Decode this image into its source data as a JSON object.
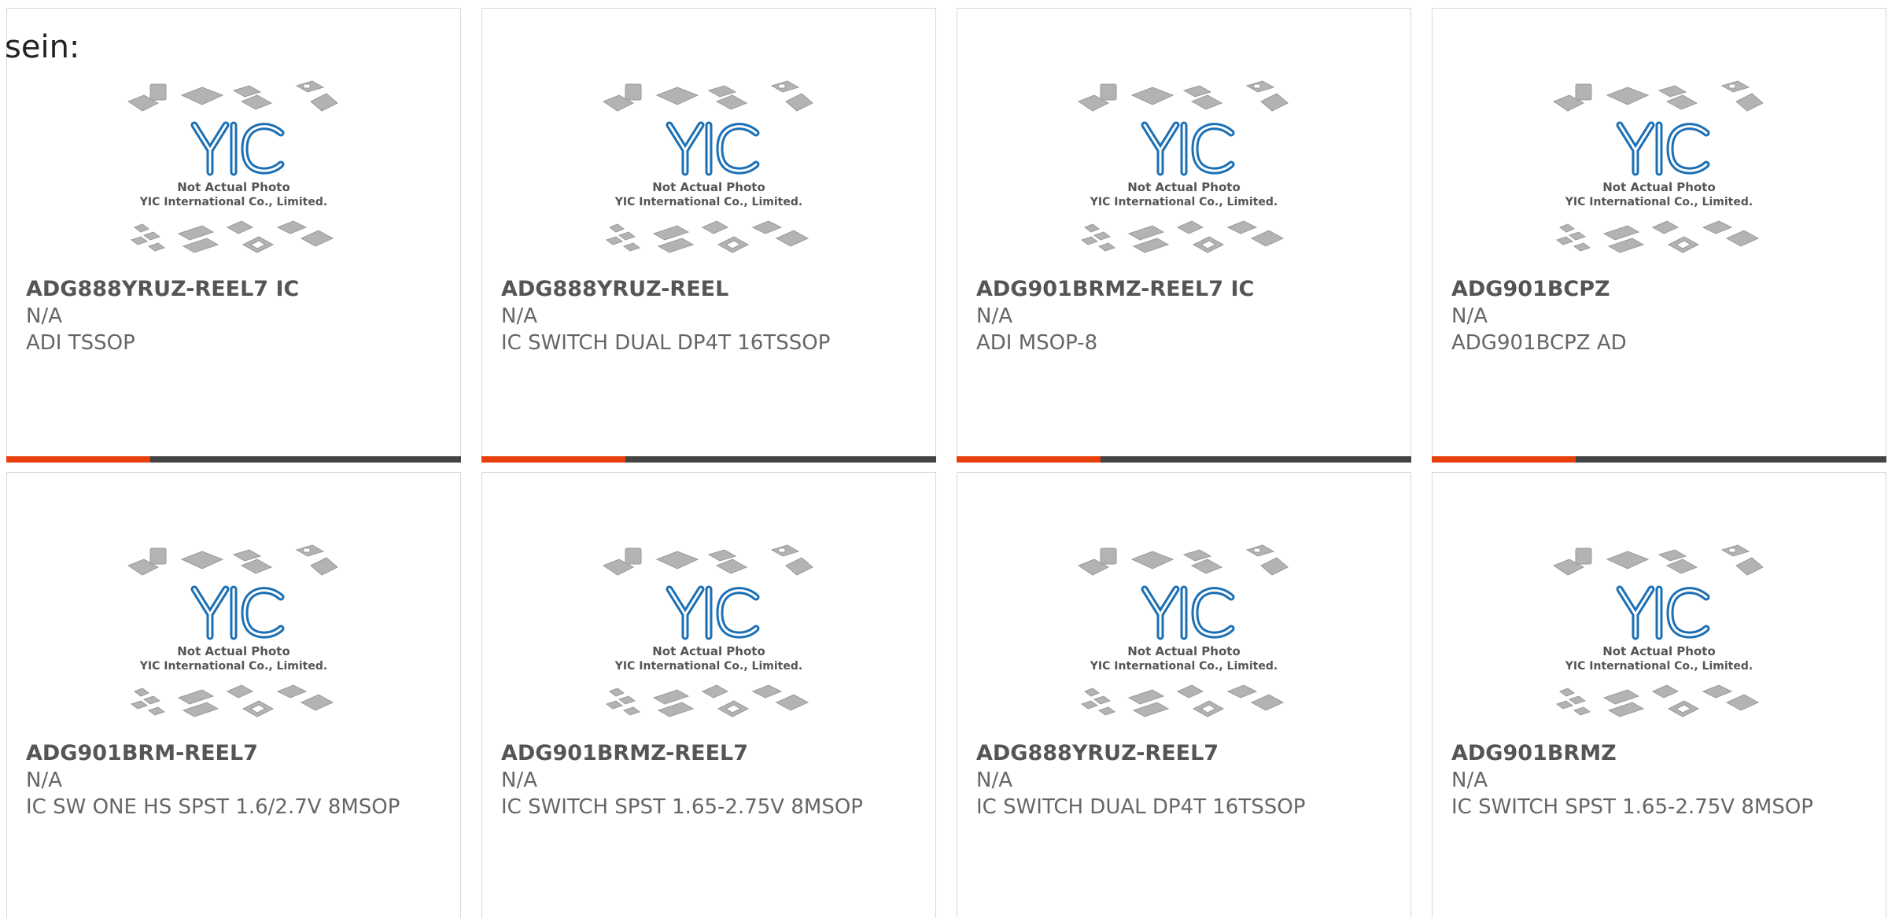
{
  "intro_text": "sein:",
  "thumbnail": {
    "logo_text": "YIC",
    "line1": "Not Actual Photo",
    "line2": "YIC International Co., Limited."
  },
  "colors": {
    "accent": "#e8400c",
    "bar": "#444444",
    "logo": "#1a73b8",
    "text": "#666666"
  },
  "products": [
    {
      "part": "ADG888YRUZ-REEL7 IC",
      "stock": "N/A",
      "desc": "ADI TSSOP"
    },
    {
      "part": "ADG888YRUZ-REEL",
      "stock": "N/A",
      "desc": "IC SWITCH DUAL DP4T 16TSSOP"
    },
    {
      "part": "ADG901BRMZ-REEL7 IC",
      "stock": "N/A",
      "desc": "ADI MSOP-8"
    },
    {
      "part": "ADG901BCPZ",
      "stock": "N/A",
      "desc": "ADG901BCPZ AD"
    },
    {
      "part": "ADG901BRM-REEL7",
      "stock": "N/A",
      "desc": "IC SW ONE HS SPST 1.6/2.7V 8MSOP"
    },
    {
      "part": "ADG901BRMZ-REEL7",
      "stock": "N/A",
      "desc": "IC SWITCH SPST 1.65-2.75V 8MSOP"
    },
    {
      "part": "ADG888YRUZ-REEL7",
      "stock": "N/A",
      "desc": "IC SWITCH DUAL DP4T 16TSSOP"
    },
    {
      "part": "ADG901BRMZ",
      "stock": "N/A",
      "desc": "IC SWITCH SPST 1.65-2.75V 8MSOP"
    }
  ]
}
